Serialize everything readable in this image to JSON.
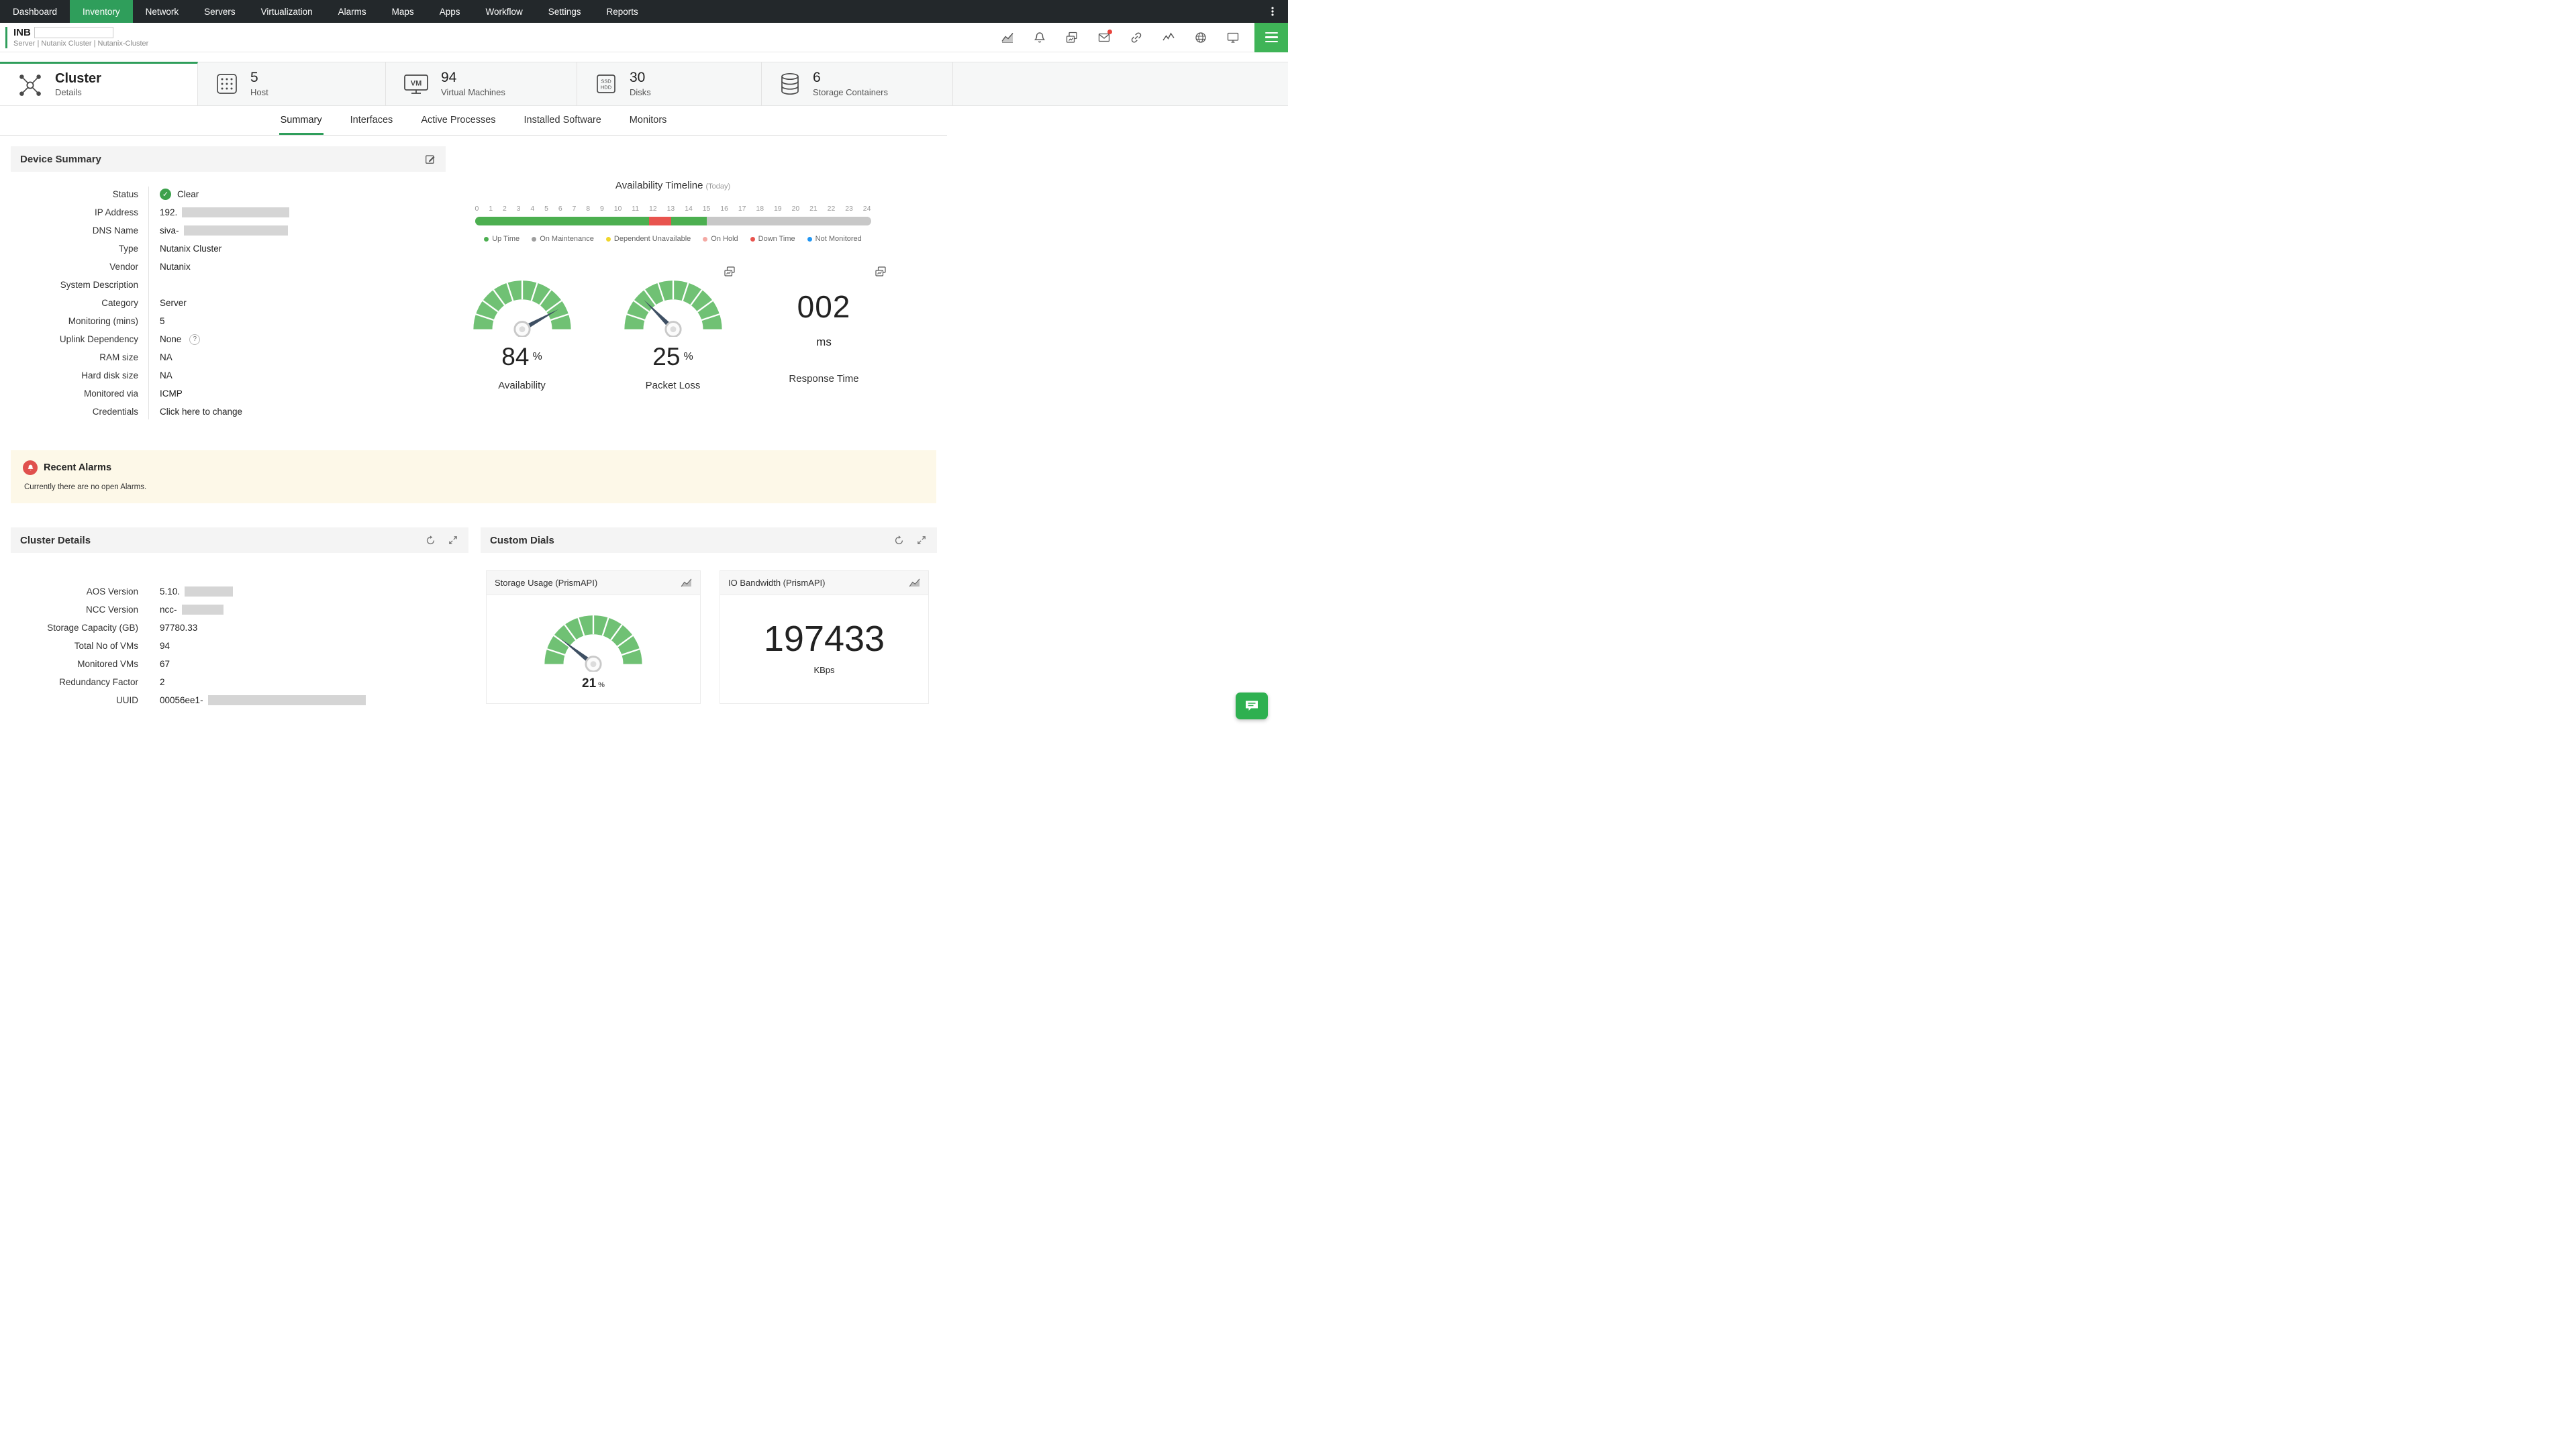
{
  "nav": {
    "active": "Inventory",
    "items": [
      "Dashboard",
      "Inventory",
      "Network",
      "Servers",
      "Virtualization",
      "Alarms",
      "Maps",
      "Apps",
      "Workflow",
      "Settings",
      "Reports"
    ]
  },
  "device_header": {
    "name": "INB",
    "breadcrumb": "Server | Nutanix Cluster | Nutanix-Cluster"
  },
  "entity_tabs": [
    {
      "title": "Cluster",
      "subtitle": "Details"
    },
    {
      "count": "5",
      "label": "Host"
    },
    {
      "count": "94",
      "label": "Virtual Machines"
    },
    {
      "count": "30",
      "label": "Disks"
    },
    {
      "count": "6",
      "label": "Storage Containers"
    }
  ],
  "sub_tabs": {
    "active": "Summary",
    "items": [
      "Summary",
      "Interfaces",
      "Active Processes",
      "Installed Software",
      "Monitors"
    ]
  },
  "device_summary": {
    "title": "Device Summary",
    "fields": [
      {
        "label": "Status",
        "value": "Clear",
        "status": true
      },
      {
        "label": "IP Address",
        "value": "192.",
        "redact": 160
      },
      {
        "label": "DNS Name",
        "value": "siva-",
        "redact": 155
      },
      {
        "label": "Type",
        "value": "Nutanix Cluster"
      },
      {
        "label": "Vendor",
        "value": "Nutanix"
      },
      {
        "label": "System Description",
        "value": ""
      },
      {
        "label": "Category",
        "value": "Server"
      },
      {
        "label": "Monitoring (mins)",
        "value": "5"
      },
      {
        "label": "Uplink Dependency",
        "value": "None",
        "help": true
      },
      {
        "label": "RAM size",
        "value": "NA"
      },
      {
        "label": "Hard disk size",
        "value": "NA"
      },
      {
        "label": "Monitored via",
        "value": "ICMP"
      },
      {
        "label": "Credentials",
        "value": "Click here to change",
        "link": true
      }
    ]
  },
  "timeline": {
    "title": "Availability Timeline",
    "subtitle": "(Today)",
    "hours": [
      "0",
      "1",
      "2",
      "3",
      "4",
      "5",
      "6",
      "7",
      "8",
      "9",
      "10",
      "11",
      "12",
      "13",
      "14",
      "15",
      "16",
      "17",
      "18",
      "19",
      "20",
      "21",
      "22",
      "23",
      "24"
    ],
    "segments": [
      {
        "state": "Up Time",
        "color": "#4caf50",
        "percent": 44
      },
      {
        "state": "Down Time",
        "color": "#e8544e",
        "percent": 5.5
      },
      {
        "state": "Up Time",
        "color": "#4caf50",
        "percent": 9
      },
      {
        "state": "Not Monitored",
        "color": "#c8c8c8",
        "percent": 41.5
      }
    ],
    "legend": [
      {
        "label": "Up Time",
        "color": "#4caf50"
      },
      {
        "label": "On Maintenance",
        "color": "#9e9e9e"
      },
      {
        "label": "Dependent Unavailable",
        "color": "#f0d62b"
      },
      {
        "label": "On Hold",
        "color": "#f4a9a3"
      },
      {
        "label": "Down Time",
        "color": "#e8544e"
      },
      {
        "label": "Not Monitored",
        "color": "#2196f3"
      }
    ]
  },
  "gauges": {
    "availability": {
      "value": 84,
      "display": "84",
      "unit": "%",
      "label": "Availability"
    },
    "packet_loss": {
      "value": 25,
      "display": "25",
      "unit": "%",
      "label": "Packet Loss"
    },
    "response_time": {
      "display": "002",
      "unit": "ms",
      "label": "Response Time"
    }
  },
  "recent_alarms": {
    "title": "Recent Alarms",
    "message": "Currently there are no open Alarms."
  },
  "cluster_details": {
    "title": "Cluster Details",
    "fields": [
      {
        "label": "AOS Version",
        "value": "5.10.",
        "redact": 72
      },
      {
        "label": "NCC Version",
        "value": "ncc-",
        "redact": 62
      },
      {
        "label": "Storage Capacity (GB)",
        "value": "97780.33"
      },
      {
        "label": "Total No of VMs",
        "value": "94"
      },
      {
        "label": "Monitored VMs",
        "value": "67"
      },
      {
        "label": "Redundancy Factor",
        "value": "2"
      },
      {
        "label": "UUID",
        "value": "00056ee1-",
        "redact": 235
      }
    ]
  },
  "custom_dials": {
    "title": "Custom Dials",
    "cards": [
      {
        "title": "Storage Usage (PrismAPI)",
        "value": 21,
        "display": "21",
        "unit": "%"
      },
      {
        "title": "IO Bandwidth (PrismAPI)",
        "display": "197433",
        "unit": "KBps"
      }
    ]
  },
  "colors": {
    "accent": "#2f9e5b",
    "gauge_green": "#70c174",
    "alarm_bg": "#fdf8e8"
  }
}
